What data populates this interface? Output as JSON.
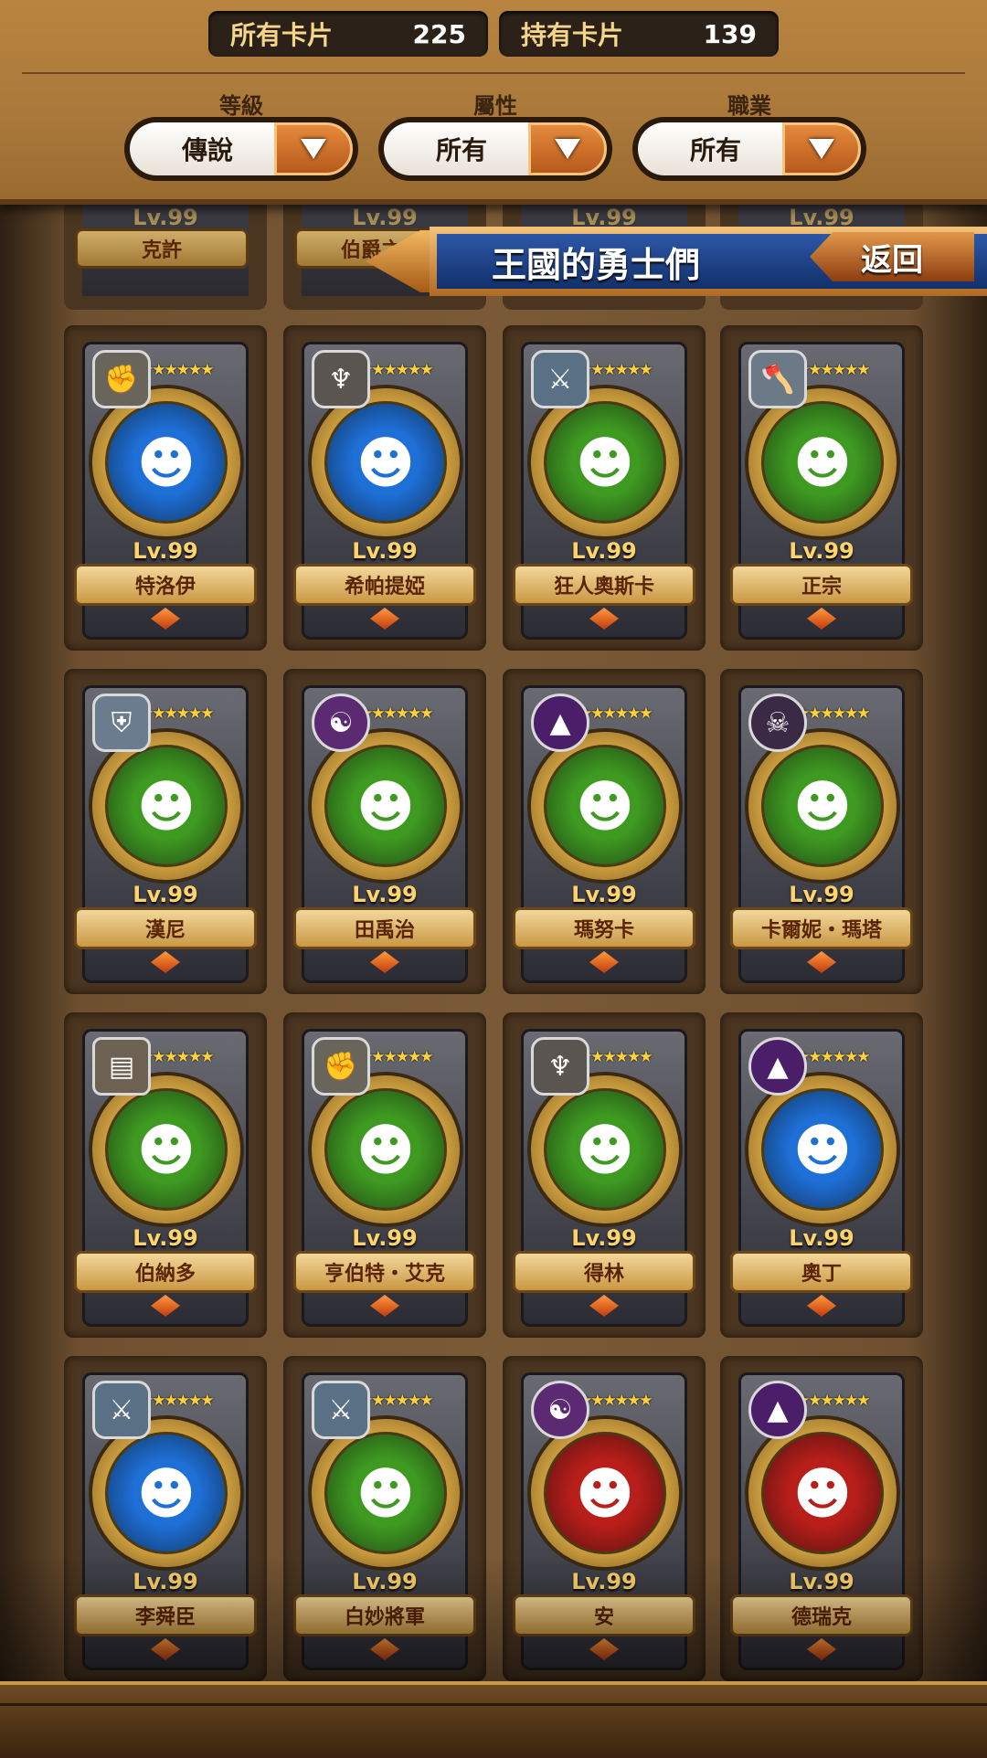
{
  "header": {
    "all_cards_label": "所有卡片",
    "all_cards_count": "225",
    "owned_cards_label": "持有卡片",
    "owned_cards_count": "139",
    "filters": [
      {
        "label": "等級",
        "value": "傳說"
      },
      {
        "label": "屬性",
        "value": "所有"
      },
      {
        "label": "職業",
        "value": "所有"
      }
    ]
  },
  "banner": {
    "title": "王國的勇士們",
    "back_label": "返回"
  },
  "partial_row": [
    {
      "level": "Lv.99",
      "name": "克許"
    },
    {
      "level": "Lv.99",
      "name": "伯爵之女"
    },
    {
      "level": "Lv.99",
      "name": ""
    },
    {
      "level": "Lv.99",
      "name": ""
    }
  ],
  "cards": [
    {
      "level": "Lv.99",
      "name": "特洛伊",
      "stars": "★★★★★★",
      "class_icon": "fist-icon",
      "bg": "#1e6fd6"
    },
    {
      "level": "Lv.99",
      "name": "希帕提婭",
      "stars": "★★★★★★",
      "class_icon": "wings-icon",
      "bg": "#1e6fd6"
    },
    {
      "level": "Lv.99",
      "name": "狂人奧斯卡",
      "stars": "★★★★★★",
      "class_icon": "sword-icon",
      "bg": "#3f9a22"
    },
    {
      "level": "Lv.99",
      "name": "正宗",
      "stars": "★★★★★★",
      "class_icon": "axe-icon",
      "bg": "#3f9a22"
    },
    {
      "level": "Lv.99",
      "name": "漢尼",
      "stars": "★★★★★★",
      "class_icon": "shield-swords-icon",
      "bg": "#3f9a22"
    },
    {
      "level": "Lv.99",
      "name": "田禹治",
      "stars": "★★★★★★",
      "class_icon": "magic-swirl-icon",
      "bg": "#3f9a22"
    },
    {
      "level": "Lv.99",
      "name": "瑪努卡",
      "stars": "★★★★★★",
      "class_icon": "witch-hat-icon",
      "bg": "#3f9a22"
    },
    {
      "level": "Lv.99",
      "name": "卡爾妮・瑪塔",
      "stars": "★★★★★★",
      "class_icon": "skull-icon",
      "bg": "#3f9a22"
    },
    {
      "level": "Lv.99",
      "name": "伯納多",
      "stars": "★★★★★★",
      "class_icon": "book-icon",
      "bg": "#3f9a22"
    },
    {
      "level": "Lv.99",
      "name": "亨伯特・艾克",
      "stars": "★★★★★★",
      "class_icon": "fist-icon",
      "bg": "#3f9a22"
    },
    {
      "level": "Lv.99",
      "name": "得林",
      "stars": "★★★★★★",
      "class_icon": "wings-icon",
      "bg": "#3f9a22"
    },
    {
      "level": "Lv.99",
      "name": "奧丁",
      "stars": "★★★★★★",
      "class_icon": "witch-hat-icon",
      "bg": "#1e6fd6"
    },
    {
      "level": "Lv.99",
      "name": "李舜臣",
      "stars": "★★★★★★",
      "class_icon": "sword-icon",
      "bg": "#1e6fd6"
    },
    {
      "level": "Lv.99",
      "name": "白妙將軍",
      "stars": "★★★★★★",
      "class_icon": "sword-icon",
      "bg": "#3f9a22"
    },
    {
      "level": "Lv.99",
      "name": "安",
      "stars": "★★★★★★",
      "class_icon": "magic-swirl-icon",
      "bg": "#b81e1a"
    },
    {
      "level": "Lv.99",
      "name": "德瑞克",
      "stars": "★★★★★★",
      "class_icon": "witch-hat-icon",
      "bg": "#b81e1a"
    }
  ]
}
